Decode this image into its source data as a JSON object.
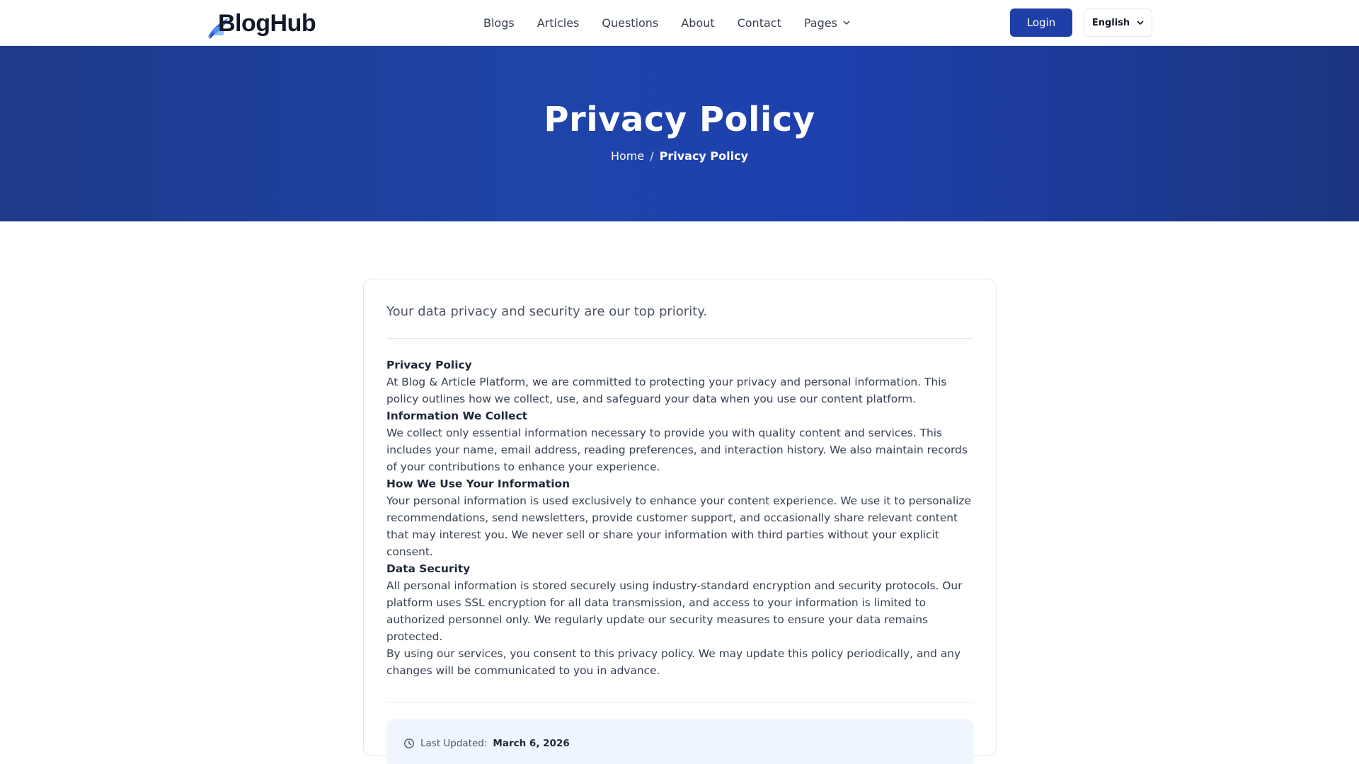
{
  "header": {
    "logo": {
      "text": "BlogHub",
      "icon": "feather-book-icon"
    },
    "nav": [
      {
        "label": "Blogs"
      },
      {
        "label": "Articles"
      },
      {
        "label": "Questions"
      },
      {
        "label": "About"
      },
      {
        "label": "Contact"
      },
      {
        "label": "Pages",
        "icon": "chevron-down-icon"
      }
    ],
    "login_label": "Login",
    "language": {
      "selected": "English",
      "icon": "chevron-down-icon"
    }
  },
  "hero": {
    "title": "Privacy Policy",
    "breadcrumb": {
      "home": "Home",
      "separator": "/",
      "current": "Privacy Policy"
    }
  },
  "content": {
    "lead": "Your data privacy and security are our top priority.",
    "sections": [
      {
        "heading": "Privacy Policy",
        "body": "At Blog & Article Platform, we are committed to protecting your privacy and personal information. This policy outlines how we collect, use, and safeguard your data when you use our content platform."
      },
      {
        "heading": "Information We Collect",
        "body": "We collect only essential information necessary to provide you with quality content and services. This includes your name, email address, reading preferences, and interaction history. We also maintain records of your contributions to enhance your experience."
      },
      {
        "heading": "How We Use Your Information",
        "body": "Your personal information is used exclusively to enhance your content experience. We use it to personalize recommendations, send newsletters, provide customer support, and occasionally share relevant content that may interest you. We never sell or share your information with third parties without your explicit consent."
      },
      {
        "heading": "Data Security",
        "body": "All personal information is stored securely using industry-standard encryption and security protocols. Our platform uses SSL encryption for all data transmission, and access to your information is limited to authorized personnel only. We regularly update our security measures to ensure your data remains protected."
      }
    ],
    "closing": "By using our services, you consent to this privacy policy. We may update this policy periodically, and any changes will be communicated to you in advance.",
    "last_updated": {
      "label": "Last Updated:",
      "date": "March 6, 2026",
      "icon": "clock-icon"
    }
  },
  "colors": {
    "primary": "#1e3ea8",
    "hero_bg": "#1e40af",
    "updated_bg": "#eff6ff"
  }
}
